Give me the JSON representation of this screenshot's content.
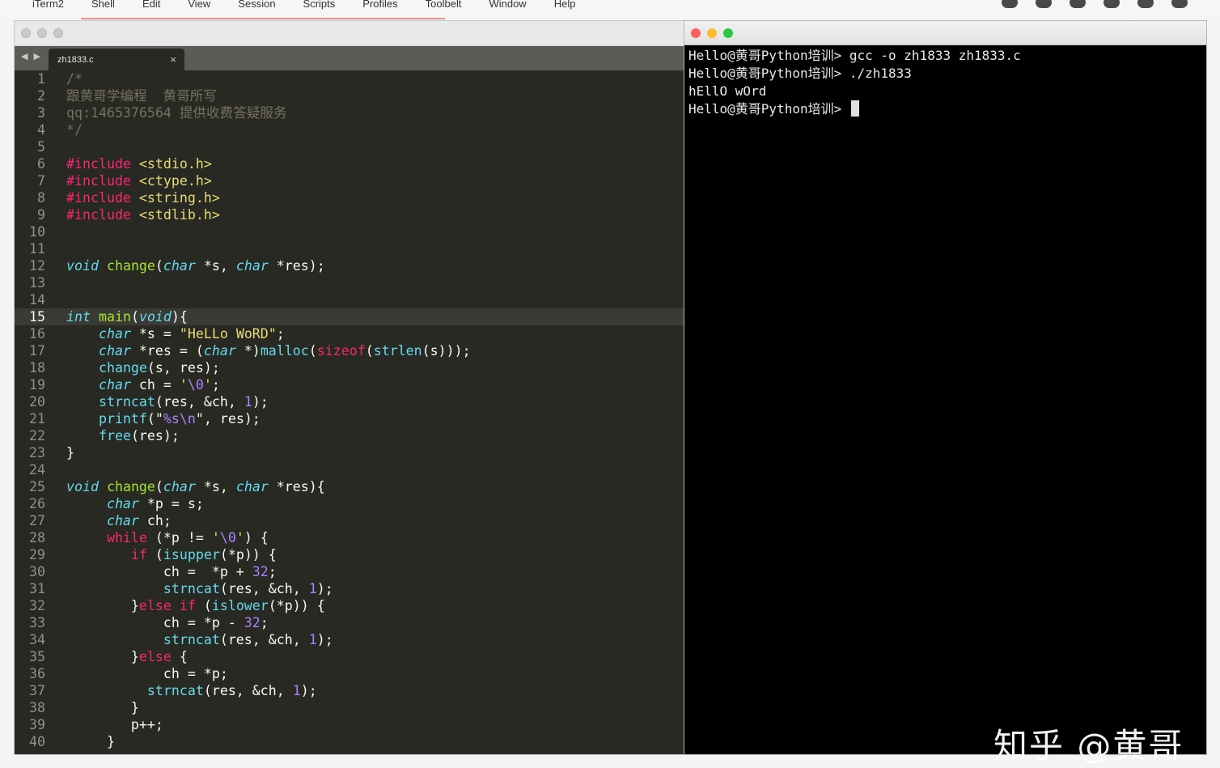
{
  "menubar": {
    "items": [
      "iTerm2",
      "Shell",
      "Edit",
      "View",
      "Session",
      "Scripts",
      "Profiles",
      "Toolbelt",
      "Window",
      "Help"
    ]
  },
  "editor": {
    "tab_nav": "◀ ▶",
    "tab_title": "zh1833.c",
    "tab_close": "×",
    "current_line": 15,
    "line_numbers": [
      "1",
      "2",
      "3",
      "4",
      "5",
      "6",
      "7",
      "8",
      "9",
      "10",
      "11",
      "12",
      "13",
      "14",
      "15",
      "16",
      "17",
      "18",
      "19",
      "20",
      "21",
      "22",
      "23",
      "24",
      "25",
      "26",
      "27",
      "28",
      "29",
      "30",
      "31",
      "32",
      "33",
      "34",
      "35",
      "36",
      "37",
      "38",
      "39",
      "40"
    ],
    "lines": [
      [
        {
          "t": "/*",
          "c": "cm"
        }
      ],
      [
        {
          "t": "跟黄哥学编程  黄哥所写",
          "c": "cm"
        }
      ],
      [
        {
          "t": "qq:1465376564 提供收费答疑服务",
          "c": "cm"
        }
      ],
      [
        {
          "t": "*/",
          "c": "cm"
        }
      ],
      [],
      [
        {
          "t": "#include ",
          "c": "pp"
        },
        {
          "t": "<stdio.h>",
          "c": "st"
        }
      ],
      [
        {
          "t": "#include ",
          "c": "pp"
        },
        {
          "t": "<ctype.h>",
          "c": "st"
        }
      ],
      [
        {
          "t": "#include ",
          "c": "pp"
        },
        {
          "t": "<string.h>",
          "c": "st"
        }
      ],
      [
        {
          "t": "#include ",
          "c": "pp"
        },
        {
          "t": "<stdlib.h>",
          "c": "st"
        }
      ],
      [],
      [],
      [
        {
          "t": "void",
          "c": "ty"
        },
        {
          "t": " "
        },
        {
          "t": "change",
          "c": "fn"
        },
        {
          "t": "("
        },
        {
          "t": "char",
          "c": "ty"
        },
        {
          "t": " *s, "
        },
        {
          "t": "char",
          "c": "ty"
        },
        {
          "t": " *res);"
        }
      ],
      [],
      [],
      [
        {
          "t": "int",
          "c": "ty"
        },
        {
          "t": " "
        },
        {
          "t": "main",
          "c": "fn"
        },
        {
          "t": "("
        },
        {
          "t": "void",
          "c": "ty"
        },
        {
          "t": "){"
        }
      ],
      [
        {
          "t": "    "
        },
        {
          "t": "char",
          "c": "ty"
        },
        {
          "t": " *s = "
        },
        {
          "t": "\"HeLLo WoRD\"",
          "c": "st"
        },
        {
          "t": ";"
        }
      ],
      [
        {
          "t": "    "
        },
        {
          "t": "char",
          "c": "ty"
        },
        {
          "t": " *res = ("
        },
        {
          "t": "char",
          "c": "ty"
        },
        {
          "t": " *)"
        },
        {
          "t": "malloc",
          "c": "bl"
        },
        {
          "t": "("
        },
        {
          "t": "sizeof",
          "c": "kw"
        },
        {
          "t": "("
        },
        {
          "t": "strlen",
          "c": "bl"
        },
        {
          "t": "(s)));"
        }
      ],
      [
        {
          "t": "    "
        },
        {
          "t": "change",
          "c": "bl"
        },
        {
          "t": "(s, res);"
        }
      ],
      [
        {
          "t": "    "
        },
        {
          "t": "char",
          "c": "ty"
        },
        {
          "t": " ch = "
        },
        {
          "t": "'",
          "c": "st"
        },
        {
          "t": "\\0",
          "c": "nu"
        },
        {
          "t": "'",
          "c": "st"
        },
        {
          "t": ";"
        }
      ],
      [
        {
          "t": "    "
        },
        {
          "t": "strncat",
          "c": "bl"
        },
        {
          "t": "(res, &ch, "
        },
        {
          "t": "1",
          "c": "nu"
        },
        {
          "t": ");"
        }
      ],
      [
        {
          "t": "    "
        },
        {
          "t": "printf",
          "c": "bl"
        },
        {
          "t": "(\""
        },
        {
          "t": "%s\\n",
          "c": "nu"
        },
        {
          "t": "\", res);"
        }
      ],
      [
        {
          "t": "    "
        },
        {
          "t": "free",
          "c": "bl"
        },
        {
          "t": "(res);"
        }
      ],
      [
        {
          "t": "}"
        }
      ],
      [],
      [
        {
          "t": "void",
          "c": "ty"
        },
        {
          "t": " "
        },
        {
          "t": "change",
          "c": "fn"
        },
        {
          "t": "("
        },
        {
          "t": "char",
          "c": "ty"
        },
        {
          "t": " *s, "
        },
        {
          "t": "char",
          "c": "ty"
        },
        {
          "t": " *res){"
        }
      ],
      [
        {
          "t": "     "
        },
        {
          "t": "char",
          "c": "ty"
        },
        {
          "t": " *p = s;"
        }
      ],
      [
        {
          "t": "     "
        },
        {
          "t": "char",
          "c": "ty"
        },
        {
          "t": " ch;"
        }
      ],
      [
        {
          "t": "     "
        },
        {
          "t": "while",
          "c": "kw"
        },
        {
          "t": " (*p != "
        },
        {
          "t": "'",
          "c": "st"
        },
        {
          "t": "\\0",
          "c": "nu"
        },
        {
          "t": "'",
          "c": "st"
        },
        {
          "t": ") {"
        }
      ],
      [
        {
          "t": "        "
        },
        {
          "t": "if",
          "c": "kw"
        },
        {
          "t": " ("
        },
        {
          "t": "isupper",
          "c": "bl"
        },
        {
          "t": "(*p)) {"
        }
      ],
      [
        {
          "t": "            ch =  *p + "
        },
        {
          "t": "32",
          "c": "nu"
        },
        {
          "t": ";"
        }
      ],
      [
        {
          "t": "            "
        },
        {
          "t": "strncat",
          "c": "bl"
        },
        {
          "t": "(res, &ch, "
        },
        {
          "t": "1",
          "c": "nu"
        },
        {
          "t": ");"
        }
      ],
      [
        {
          "t": "        }"
        },
        {
          "t": "else if",
          "c": "kw"
        },
        {
          "t": " ("
        },
        {
          "t": "islower",
          "c": "bl"
        },
        {
          "t": "(*p)) {"
        }
      ],
      [
        {
          "t": "            ch = *p - "
        },
        {
          "t": "32",
          "c": "nu"
        },
        {
          "t": ";"
        }
      ],
      [
        {
          "t": "            "
        },
        {
          "t": "strncat",
          "c": "bl"
        },
        {
          "t": "(res, &ch, "
        },
        {
          "t": "1",
          "c": "nu"
        },
        {
          "t": ");"
        }
      ],
      [
        {
          "t": "        }"
        },
        {
          "t": "else",
          "c": "kw"
        },
        {
          "t": " {"
        }
      ],
      [
        {
          "t": "            ch = *p;"
        }
      ],
      [
        {
          "t": "          "
        },
        {
          "t": "strncat",
          "c": "bl"
        },
        {
          "t": "(res, &ch, "
        },
        {
          "t": "1",
          "c": "nu"
        },
        {
          "t": ");"
        }
      ],
      [
        {
          "t": "        }"
        }
      ],
      [
        {
          "t": "        p++;"
        }
      ],
      [
        {
          "t": "     }"
        }
      ]
    ]
  },
  "terminal": {
    "lines": [
      "Hello@黄哥Python培训> gcc -o zh1833 zh1833.c",
      "Hello@黄哥Python培训> ./zh1833",
      "hEllO wOrd",
      "Hello@黄哥Python培训> "
    ]
  },
  "watermark": "知乎 @黄哥"
}
